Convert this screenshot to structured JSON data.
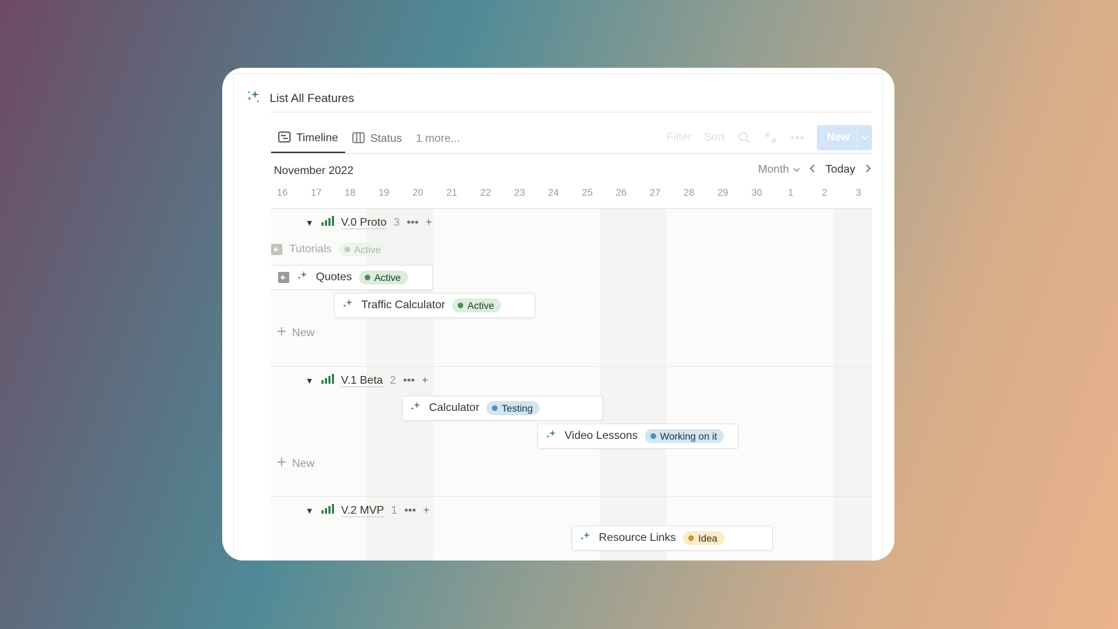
{
  "page": {
    "title": "List All Features"
  },
  "tabs": [
    {
      "label": "Timeline",
      "icon": "timeline-icon"
    },
    {
      "label": "Status",
      "icon": "board-icon"
    },
    {
      "label": "1 more..."
    }
  ],
  "toolbar": {
    "filter": "Filter",
    "sort": "Sort",
    "new_label": "New"
  },
  "timeline": {
    "month_label": "November 2022",
    "mode": "Month",
    "today": "Today",
    "days": [
      "16",
      "17",
      "18",
      "19",
      "20",
      "21",
      "22",
      "23",
      "24",
      "25",
      "26",
      "27",
      "28",
      "29",
      "30",
      "1",
      "2",
      "3"
    ]
  },
  "groups": [
    {
      "name": "V.0 Proto",
      "count": "3",
      "items": [
        {
          "title": "Tutorials",
          "status": "Active",
          "color": "#4d8a5d"
        },
        {
          "title": "Quotes",
          "status": "Active",
          "color": "#4d8a5d"
        },
        {
          "title": "Traffic Calculator",
          "status": "Active",
          "color": "#4d8a5d"
        }
      ],
      "new_label": "New"
    },
    {
      "name": "V.1 Beta",
      "count": "2",
      "items": [
        {
          "title": "Calculator",
          "status": "Testing",
          "color": "#4f8dc0"
        },
        {
          "title": "Video Lessons",
          "status": "Working on it",
          "color": "#4f8dc0"
        }
      ],
      "new_label": "New"
    },
    {
      "name": "V.2 MVP",
      "count": "1",
      "items": [
        {
          "title": "Resource Links",
          "status": "Idea",
          "color": "#cb912f"
        }
      ]
    }
  ]
}
